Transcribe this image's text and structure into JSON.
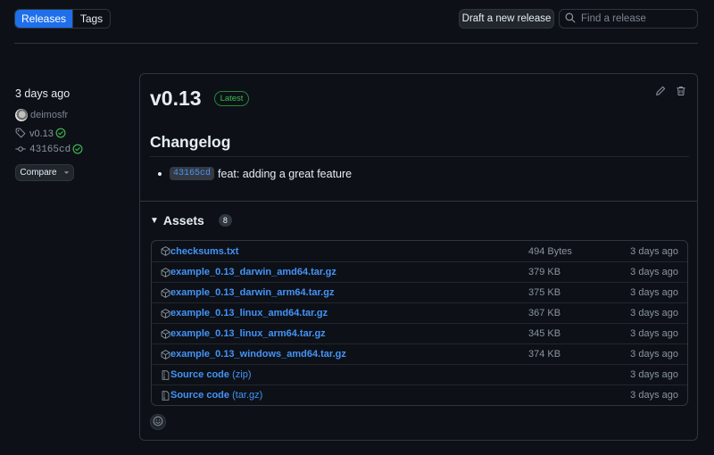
{
  "tabs": [
    {
      "label": "Releases",
      "active": true
    },
    {
      "label": "Tags",
      "active": false
    }
  ],
  "toolbar": {
    "draft_label": "Draft a new release",
    "search_placeholder": "Find a release",
    "search_value": ""
  },
  "meta": {
    "date": "3 days ago",
    "author": "deimosfr",
    "tag": "v0.13",
    "commit": "43165cd",
    "compare_label": "Compare"
  },
  "release": {
    "title": "v0.13",
    "badge": "Latest",
    "changelog_heading": "Changelog",
    "changelog": [
      {
        "commit": "43165cd",
        "text": "feat: adding a great feature"
      }
    ],
    "assets_label": "Assets",
    "assets_count": "8",
    "assets": [
      {
        "icon": "package-icon",
        "name": "checksums.txt",
        "suffix": "",
        "size": "494 Bytes",
        "date": "3 days ago"
      },
      {
        "icon": "package-icon",
        "name": "example_0.13_darwin_amd64.tar.gz",
        "suffix": "",
        "size": "379 KB",
        "date": "3 days ago"
      },
      {
        "icon": "package-icon",
        "name": "example_0.13_darwin_arm64.tar.gz",
        "suffix": "",
        "size": "375 KB",
        "date": "3 days ago"
      },
      {
        "icon": "package-icon",
        "name": "example_0.13_linux_amd64.tar.gz",
        "suffix": "",
        "size": "367 KB",
        "date": "3 days ago"
      },
      {
        "icon": "package-icon",
        "name": "example_0.13_linux_arm64.tar.gz",
        "suffix": "",
        "size": "345 KB",
        "date": "3 days ago"
      },
      {
        "icon": "package-icon",
        "name": "example_0.13_windows_amd64.tar.gz",
        "suffix": "",
        "size": "374 KB",
        "date": "3 days ago"
      },
      {
        "icon": "file-zip-icon",
        "name": "Source code",
        "suffix": "(zip)",
        "size": "",
        "date": "3 days ago"
      },
      {
        "icon": "file-zip-icon",
        "name": "Source code",
        "suffix": "(tar.gz)",
        "size": "",
        "date": "3 days ago"
      }
    ]
  },
  "colors": {
    "accent": "#1f6feb",
    "link": "#4493f8",
    "success": "#3fb950",
    "background": "#0d1117",
    "border": "#30363d"
  }
}
